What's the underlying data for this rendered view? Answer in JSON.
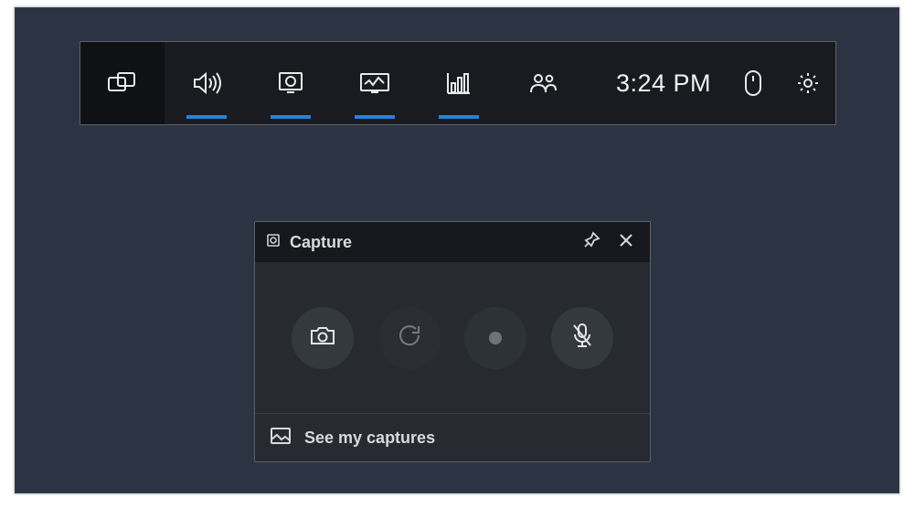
{
  "topbar": {
    "time": "3:24 PM"
  },
  "capture": {
    "title": "Capture",
    "footer": "See my captures"
  }
}
